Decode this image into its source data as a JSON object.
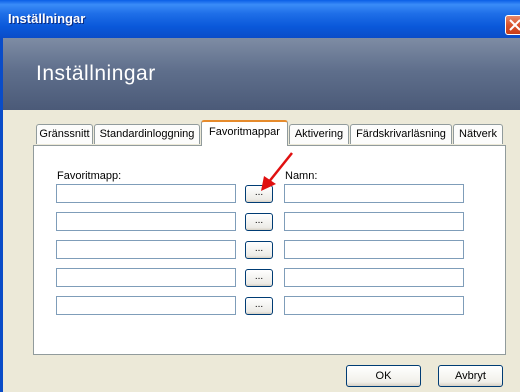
{
  "window": {
    "title": "Inställningar"
  },
  "header": {
    "title": "Inställningar"
  },
  "tabs": [
    {
      "label": "Gränssnitt"
    },
    {
      "label": "Standardinloggning"
    },
    {
      "label": "Favoritmappar"
    },
    {
      "label": "Aktivering"
    },
    {
      "label": "Färdskrivarläsning"
    },
    {
      "label": "Nätverk"
    }
  ],
  "active_tab": "Favoritmappar",
  "favorites": {
    "folder_label": "Favoritmapp:",
    "name_label": "Namn:",
    "browse_label": "...",
    "rows": [
      {
        "folder": "",
        "name": ""
      },
      {
        "folder": "",
        "name": ""
      },
      {
        "folder": "",
        "name": ""
      },
      {
        "folder": "",
        "name": ""
      },
      {
        "folder": "",
        "name": ""
      }
    ]
  },
  "buttons": {
    "ok": "OK",
    "cancel": "Avbryt"
  },
  "colors": {
    "titlebar": "#0a58da",
    "header_band": "#5f6f8c",
    "tab_accent": "#e68b2c",
    "arrow": "#e01010"
  }
}
